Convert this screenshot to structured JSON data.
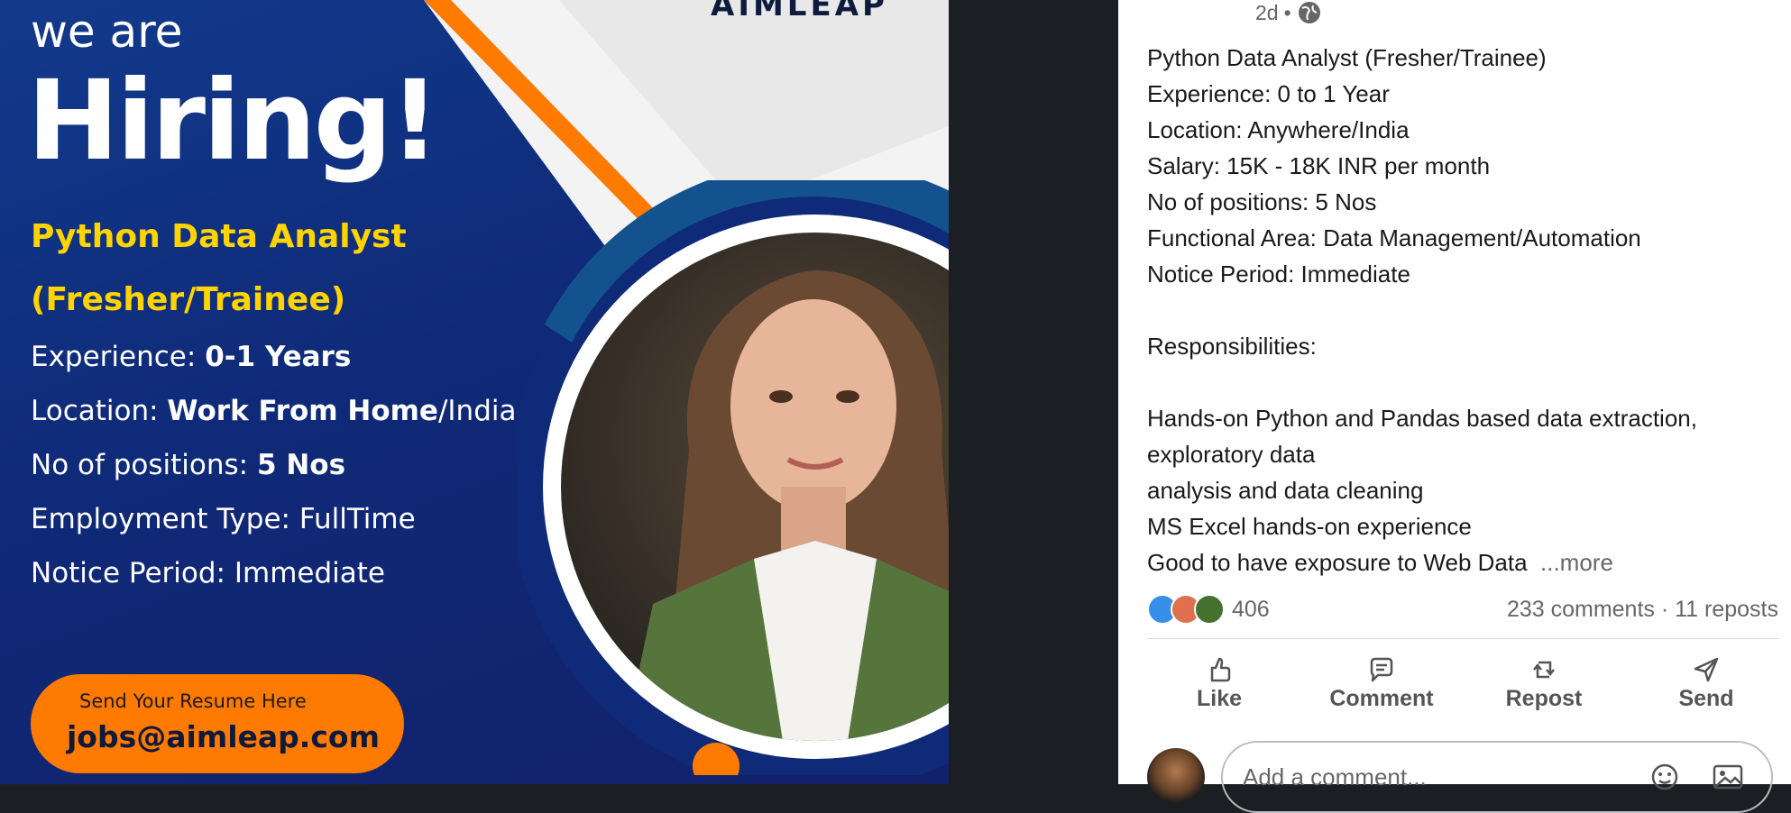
{
  "poster": {
    "logo": "AIMLEAP",
    "we_are": "we are",
    "hiring": "Hiring!",
    "role_line1": "Python Data Analyst",
    "role_line2": "(Fresher/Trainee)",
    "details": [
      {
        "label": "Experience: ",
        "value": "0-1 Years",
        "suffix": ""
      },
      {
        "label": "Location: ",
        "value": "Work From Home",
        "suffix": "/India"
      },
      {
        "label": "No of positions: ",
        "value": "5 Nos",
        "suffix": ""
      },
      {
        "label": "Employment Type: FullTime",
        "value": "",
        "suffix": ""
      },
      {
        "label": "Notice Period: Immediate",
        "value": "",
        "suffix": ""
      }
    ],
    "cta_small": "Send Your Resume Here",
    "cta_email": "jobs@aimleap.com"
  },
  "post": {
    "age": "2d",
    "separator": "•",
    "lines": [
      "Python Data Analyst (Fresher/Trainee)",
      "Experience: 0 to 1 Year",
      "Location: Anywhere/India",
      "Salary: 15K - 18K INR per month",
      "No of positions: 5 Nos",
      "Functional Area: Data Management/Automation",
      "Notice Period: Immediate",
      "",
      "Responsibilities:",
      "",
      "Hands-on Python and Pandas based data extraction,",
      "exploratory data",
      "analysis and data cleaning",
      "MS Excel hands-on experience"
    ],
    "last_line": "Good to have exposure to Web Data",
    "more": "...more"
  },
  "stats": {
    "reactions_count": "406",
    "comments_reposts": "233 comments · 11 reposts"
  },
  "actions": {
    "like": "Like",
    "comment": "Comment",
    "repost": "Repost",
    "send": "Send"
  },
  "comment": {
    "placeholder": "Add a comment..."
  },
  "colors": {
    "poster_blue": "#13206a",
    "poster_yellow": "#ffd400",
    "poster_orange": "#ff7a00",
    "react_like": "#378fe9",
    "react_love": "#df704d",
    "react_insight": "#44712e"
  }
}
